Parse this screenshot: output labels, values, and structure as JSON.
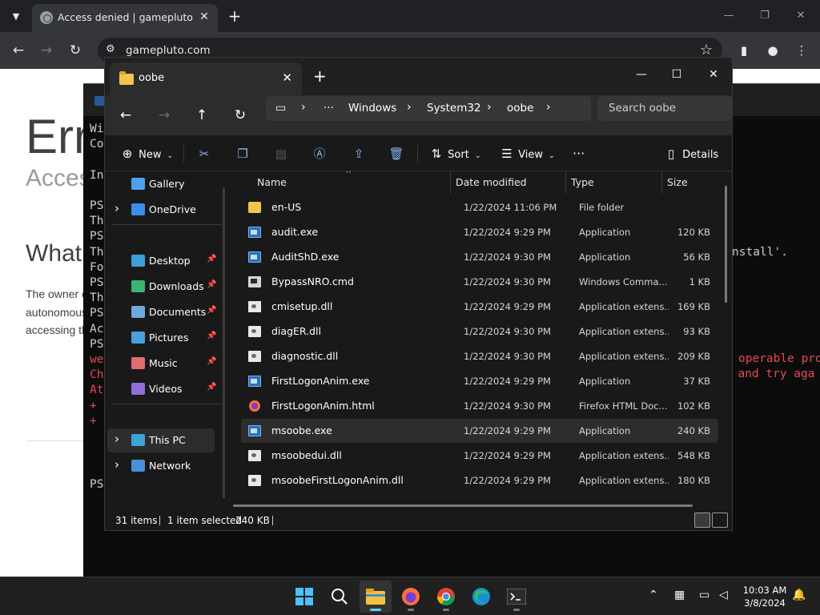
{
  "browser": {
    "tab_title": "Access denied | gamepluto.com",
    "url": "gamepluto.com"
  },
  "webpage": {
    "heading": "Error",
    "subheading": "Access denied",
    "section_heading": "What happened?",
    "paragraph_lines": [
      "The owner of this website",
      "autonomous system number",
      "accessing this website."
    ]
  },
  "terminal": {
    "left_lines": [
      {
        "text": "Wi",
        "color": "normal"
      },
      {
        "text": "Co",
        "color": "normal"
      },
      {
        "text": "",
        "color": "normal"
      },
      {
        "text": "In",
        "color": "normal"
      },
      {
        "text": "",
        "color": "normal"
      },
      {
        "text": "PS",
        "color": "normal"
      },
      {
        "text": "Th",
        "color": "normal"
      },
      {
        "text": "PS",
        "color": "normal"
      },
      {
        "text": "Th",
        "color": "normal"
      },
      {
        "text": "Fo",
        "color": "normal"
      },
      {
        "text": "PS",
        "color": "normal"
      },
      {
        "text": "Th",
        "color": "normal"
      },
      {
        "text": "PS",
        "color": "normal"
      },
      {
        "text": "Ac",
        "color": "normal"
      },
      {
        "text": "PS",
        "color": "normal"
      },
      {
        "text": "we",
        "color": "red"
      },
      {
        "text": "Ch",
        "color": "red"
      },
      {
        "text": "At",
        "color": "red"
      },
      {
        "text": "+",
        "color": "red"
      },
      {
        "text": "+",
        "color": "red"
      }
    ],
    "prompt_bottom": "PS",
    "right_fragments": [
      {
        "text": "nstall'.",
        "color": "normal"
      },
      {
        "text": "operable pro",
        "color": "red"
      },
      {
        "text": "t and try aga",
        "color": "red"
      }
    ]
  },
  "explorer": {
    "tab_title": "oobe",
    "breadcrumb": [
      "Windows",
      "System32",
      "oobe"
    ],
    "search_placeholder": "Search oobe",
    "commands": {
      "new": "New",
      "sort": "Sort",
      "view": "View",
      "details": "Details"
    },
    "nav_items": [
      {
        "label": "Gallery",
        "icon": "gallery-icon",
        "expandable": false,
        "pinned": false,
        "color": "#4ea1f0"
      },
      {
        "label": "OneDrive",
        "icon": "cloud-icon",
        "expandable": true,
        "pinned": false,
        "color": "#3b8eea"
      },
      {
        "label": "Desktop",
        "icon": "desktop-icon",
        "expandable": false,
        "pinned": true,
        "color": "#3ba0d8"
      },
      {
        "label": "Downloads",
        "icon": "download-icon",
        "expandable": false,
        "pinned": true,
        "color": "#3cb371"
      },
      {
        "label": "Documents",
        "icon": "document-icon",
        "expandable": false,
        "pinned": true,
        "color": "#6fa8dc"
      },
      {
        "label": "Pictures",
        "icon": "pictures-icon",
        "expandable": false,
        "pinned": true,
        "color": "#4a9fe0"
      },
      {
        "label": "Music",
        "icon": "music-icon",
        "expandable": false,
        "pinned": true,
        "color": "#e06c6c"
      },
      {
        "label": "Videos",
        "icon": "videos-icon",
        "expandable": false,
        "pinned": true,
        "color": "#8e6fd8"
      },
      {
        "label": "This PC",
        "icon": "computer-icon",
        "expandable": true,
        "pinned": false,
        "color": "#3aa6d6"
      },
      {
        "label": "Network",
        "icon": "network-icon",
        "expandable": true,
        "pinned": false,
        "color": "#4a90d9"
      }
    ],
    "columns": [
      "Name",
      "Date modified",
      "Type",
      "Size"
    ],
    "files": [
      {
        "name": "en-US",
        "date": "1/22/2024 11:06 PM",
        "type": "File folder",
        "size": "",
        "kind": "folder"
      },
      {
        "name": "audit.exe",
        "date": "1/22/2024 9:29 PM",
        "type": "Application",
        "size": "120 KB",
        "kind": "exe"
      },
      {
        "name": "AuditShD.exe",
        "date": "1/22/2024 9:30 PM",
        "type": "Application",
        "size": "56 KB",
        "kind": "exe"
      },
      {
        "name": "BypassNRO.cmd",
        "date": "1/22/2024 9:30 PM",
        "type": "Windows Comma...",
        "size": "1 KB",
        "kind": "cmdf"
      },
      {
        "name": "cmisetup.dll",
        "date": "1/22/2024 9:29 PM",
        "type": "Application extens...",
        "size": "169 KB",
        "kind": "dll"
      },
      {
        "name": "diagER.dll",
        "date": "1/22/2024 9:30 PM",
        "type": "Application extens...",
        "size": "93 KB",
        "kind": "dll"
      },
      {
        "name": "diagnostic.dll",
        "date": "1/22/2024 9:30 PM",
        "type": "Application extens...",
        "size": "209 KB",
        "kind": "dll"
      },
      {
        "name": "FirstLogonAnim.exe",
        "date": "1/22/2024 9:29 PM",
        "type": "Application",
        "size": "37 KB",
        "kind": "exe"
      },
      {
        "name": "FirstLogonAnim.html",
        "date": "1/22/2024 9:30 PM",
        "type": "Firefox HTML Doc...",
        "size": "102 KB",
        "kind": "html"
      },
      {
        "name": "msoobe.exe",
        "date": "1/22/2024 9:29 PM",
        "type": "Application",
        "size": "240 KB",
        "kind": "exe",
        "selected": true
      },
      {
        "name": "msoobedui.dll",
        "date": "1/22/2024 9:29 PM",
        "type": "Application extens...",
        "size": "548 KB",
        "kind": "dll"
      },
      {
        "name": "msoobeFirstLogonAnim.dll",
        "date": "1/22/2024 9:29 PM",
        "type": "Application extens...",
        "size": "180 KB",
        "kind": "dll"
      }
    ],
    "status": {
      "item_count": "31 items",
      "selection": "1 item selected",
      "selection_size": "240 KB"
    }
  },
  "taskbar": {
    "time": "10:03 AM",
    "date": "3/8/2024",
    "apps": [
      "start-icon",
      "search-icon",
      "file-explorer-icon",
      "firefox-icon",
      "chrome-icon",
      "edge-icon",
      "terminal-icon"
    ]
  }
}
